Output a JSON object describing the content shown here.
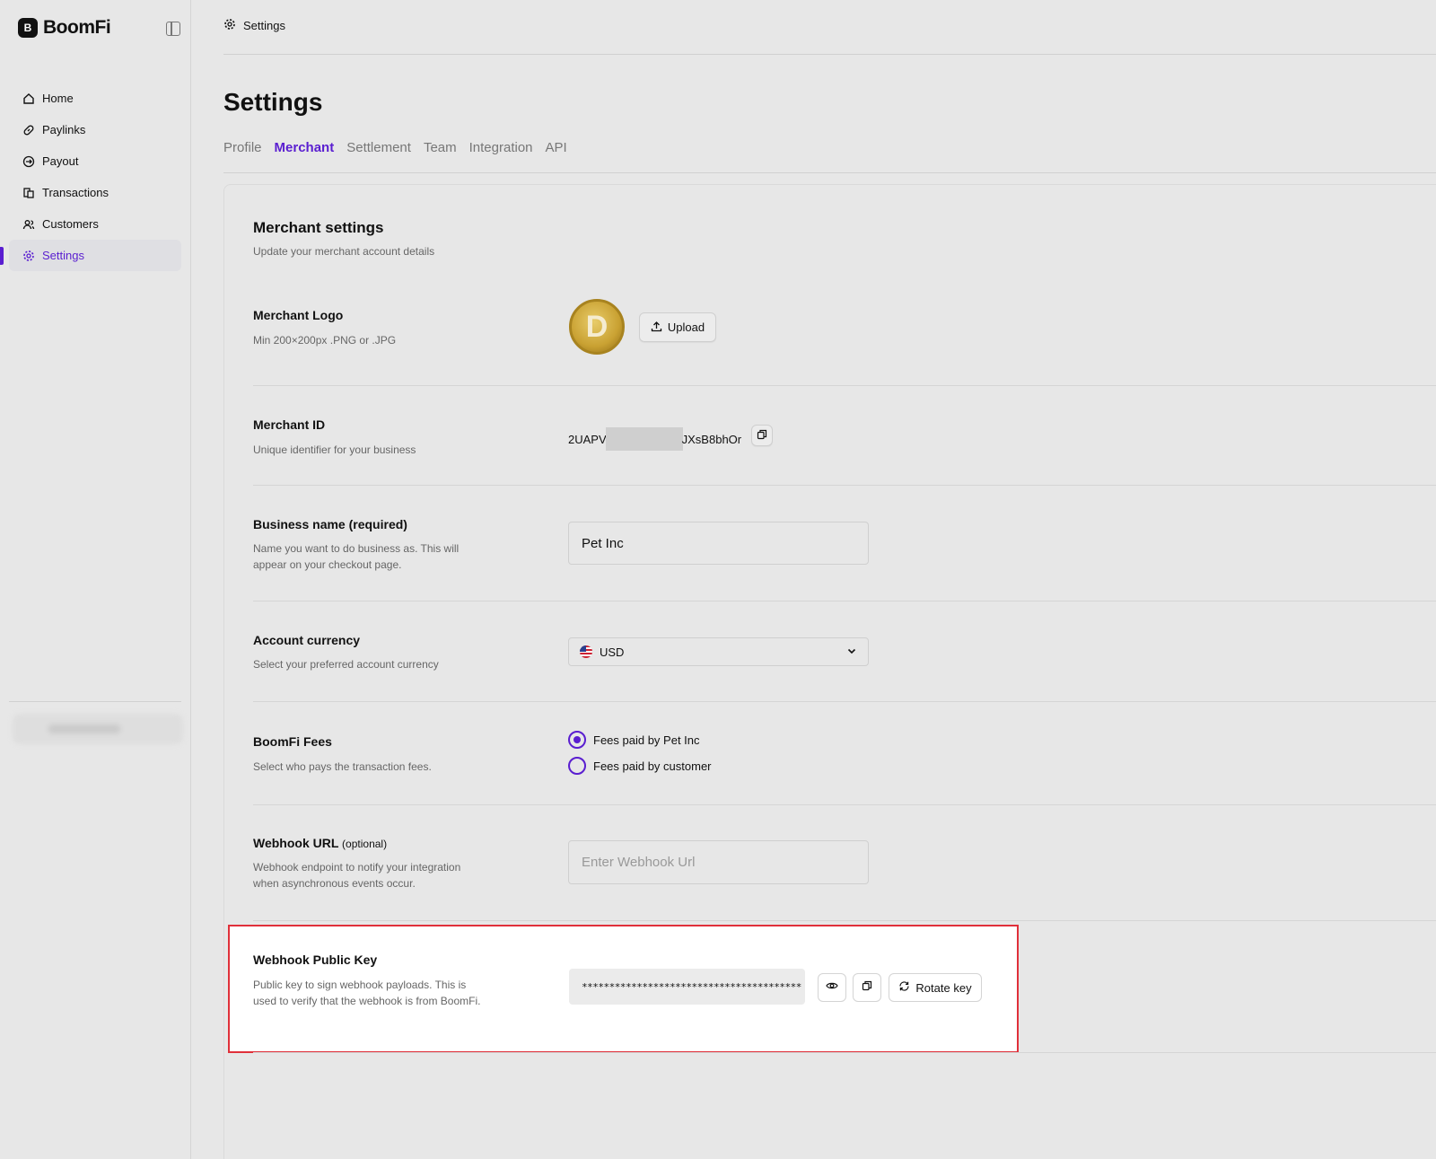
{
  "brand": {
    "mark": "B",
    "name": "BoomFi"
  },
  "sidebar": {
    "items": [
      {
        "label": "Home",
        "icon": "home-icon"
      },
      {
        "label": "Paylinks",
        "icon": "link-icon"
      },
      {
        "label": "Payout",
        "icon": "payout-icon"
      },
      {
        "label": "Transactions",
        "icon": "transactions-icon"
      },
      {
        "label": "Customers",
        "icon": "customers-icon"
      },
      {
        "label": "Settings",
        "icon": "gear-icon",
        "active": true
      }
    ]
  },
  "breadcrumb": {
    "label": "Settings"
  },
  "page": {
    "title": "Settings"
  },
  "tabs": [
    "Profile",
    "Merchant",
    "Settlement",
    "Team",
    "Integration",
    "API"
  ],
  "active_tab": "Merchant",
  "merchant": {
    "title": "Merchant settings",
    "subtitle": "Update your merchant account details",
    "logo": {
      "label": "Merchant Logo",
      "desc": "Min 200×200px .PNG or .JPG",
      "upload_label": "Upload"
    },
    "id": {
      "label": "Merchant ID",
      "desc": "Unique identifier for your business",
      "prefix": "2UAPV",
      "suffix": "JXsB8bhOr"
    },
    "business_name": {
      "label": "Business name (required)",
      "desc": "Name you want to do business as. This will appear on your checkout page.",
      "value": "Pet Inc"
    },
    "currency": {
      "label": "Account currency",
      "desc": "Select your preferred account currency",
      "value": "USD"
    },
    "fees": {
      "label": "BoomFi Fees",
      "desc": "Select who pays the transaction fees.",
      "options": [
        "Fees paid by Pet Inc",
        "Fees paid by customer"
      ],
      "selected": 0
    },
    "webhook_url": {
      "label": "Webhook URL",
      "optional": "(optional)",
      "desc": "Webhook endpoint to notify your integration when asynchronous events occur.",
      "placeholder": "Enter Webhook Url"
    },
    "webhook_key": {
      "label": "Webhook Public Key",
      "desc": "Public key to sign webhook payloads. This is used to verify that the webhook is from BoomFi.",
      "masked_value": "****************************************",
      "rotate_label": "Rotate key"
    }
  },
  "colors": {
    "accent": "#5a1ed0",
    "highlight": "#e0303a"
  }
}
